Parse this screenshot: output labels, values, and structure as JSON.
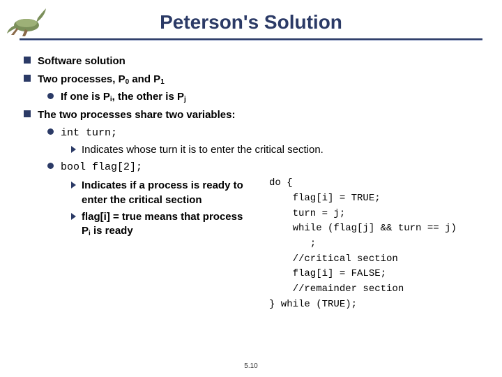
{
  "title": "Peterson's Solution",
  "bullets": {
    "b1": "Software solution",
    "b2_pre": "Two processes, P",
    "b2_mid": " and P",
    "b2_s0": "0",
    "b2_s1": "1",
    "b2a_pre": "If one is P",
    "b2a_mid": ", the other is P",
    "b2a_si": "i",
    "b2a_sj": "j",
    "b3": "The two processes share two variables:",
    "b3a_code": "int turn;",
    "b3a1": "Indicates whose turn it is to enter the critical section.",
    "b3b_code": "bool flag[2];",
    "b3b1": "Indicates if a process is ready to enter the critical section",
    "b3b2_pre": "flag[i] = true means that process P",
    "b3b2_si": "i",
    "b3b2_post": " is ready"
  },
  "code": "do {\n    flag[i] = TRUE;\n    turn = j;\n    while (flag[j] && turn == j)\n       ;\n    //critical section\n    flag[i] = FALSE;\n    //remainder section\n} while (TRUE);",
  "pagenum": "5.10"
}
